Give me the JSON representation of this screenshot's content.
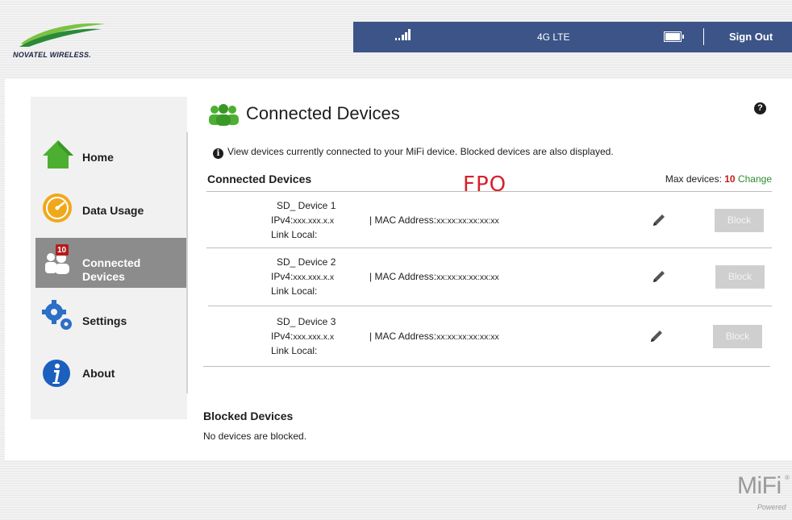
{
  "brand": {
    "logo_text": "NOVATEL WIRELESS.",
    "footer_brand": "MiFi",
    "footer_reg": "®",
    "footer_sub": "Powered"
  },
  "topbar": {
    "signal_icon": "signal-bars-icon",
    "network_type": "4G LTE",
    "battery_icon": "battery-full-icon",
    "sign_out_label": "Sign Out",
    "bar_color": "#3c5488"
  },
  "sidebar": {
    "items": [
      {
        "label": "Home",
        "icon": "home-icon",
        "active": false
      },
      {
        "label": "Data Usage",
        "icon": "data-usage-gauge-icon",
        "active": false
      },
      {
        "label": "Connected",
        "label2": "Devices",
        "icon": "connected-devices-icon",
        "badge": "10",
        "active": true
      },
      {
        "label": "Settings",
        "icon": "settings-gears-icon",
        "active": false
      },
      {
        "label": "About",
        "icon": "info-icon",
        "active": false
      }
    ]
  },
  "main": {
    "page_title": "Connected Devices",
    "help_icon": "?",
    "info_icon": "i",
    "info_text": "View devices currently connected to your MiFi device. Blocked devices are also displayed.",
    "connected_heading": "Connected Devices",
    "watermark": "FPO",
    "max_devices_label": "Max devices:",
    "max_devices_value": "10",
    "change_label": "Change",
    "devices": [
      {
        "name": "SD_ Device 1",
        "ipv4_label": "IPv4:",
        "ipv4": "xxx.xxx.x.x",
        "mac_label": "| MAC Address:",
        "mac": "xx:xx:xx:xx:xx:xx",
        "link_local": "Link Local:",
        "block_label": "Block"
      },
      {
        "name": "SD_ Device 2",
        "ipv4_label": "IPv4:",
        "ipv4": "xxx.xxx.x.x",
        "mac_label": "| MAC Address:",
        "mac": "xx:xx:xx:xx:xx:xx",
        "link_local": "Link Local:",
        "block_label": "Block"
      },
      {
        "name": "SD_ Device 3",
        "ipv4_label": "IPv4:",
        "ipv4": "xxx.xxx.x.x",
        "mac_label": "| MAC Address:",
        "mac": "xx:xx:xx:xx:xx:xx",
        "link_local": "Link Local:",
        "block_label": "Block"
      }
    ],
    "blocked_heading": "Blocked Devices",
    "blocked_text": "No devices are blocked."
  },
  "colors": {
    "accent_red": "#c71a1a",
    "change_green": "#2f8b2f",
    "watermark_red": "#d8202c",
    "sidebar_active": "#8c8c8c"
  }
}
